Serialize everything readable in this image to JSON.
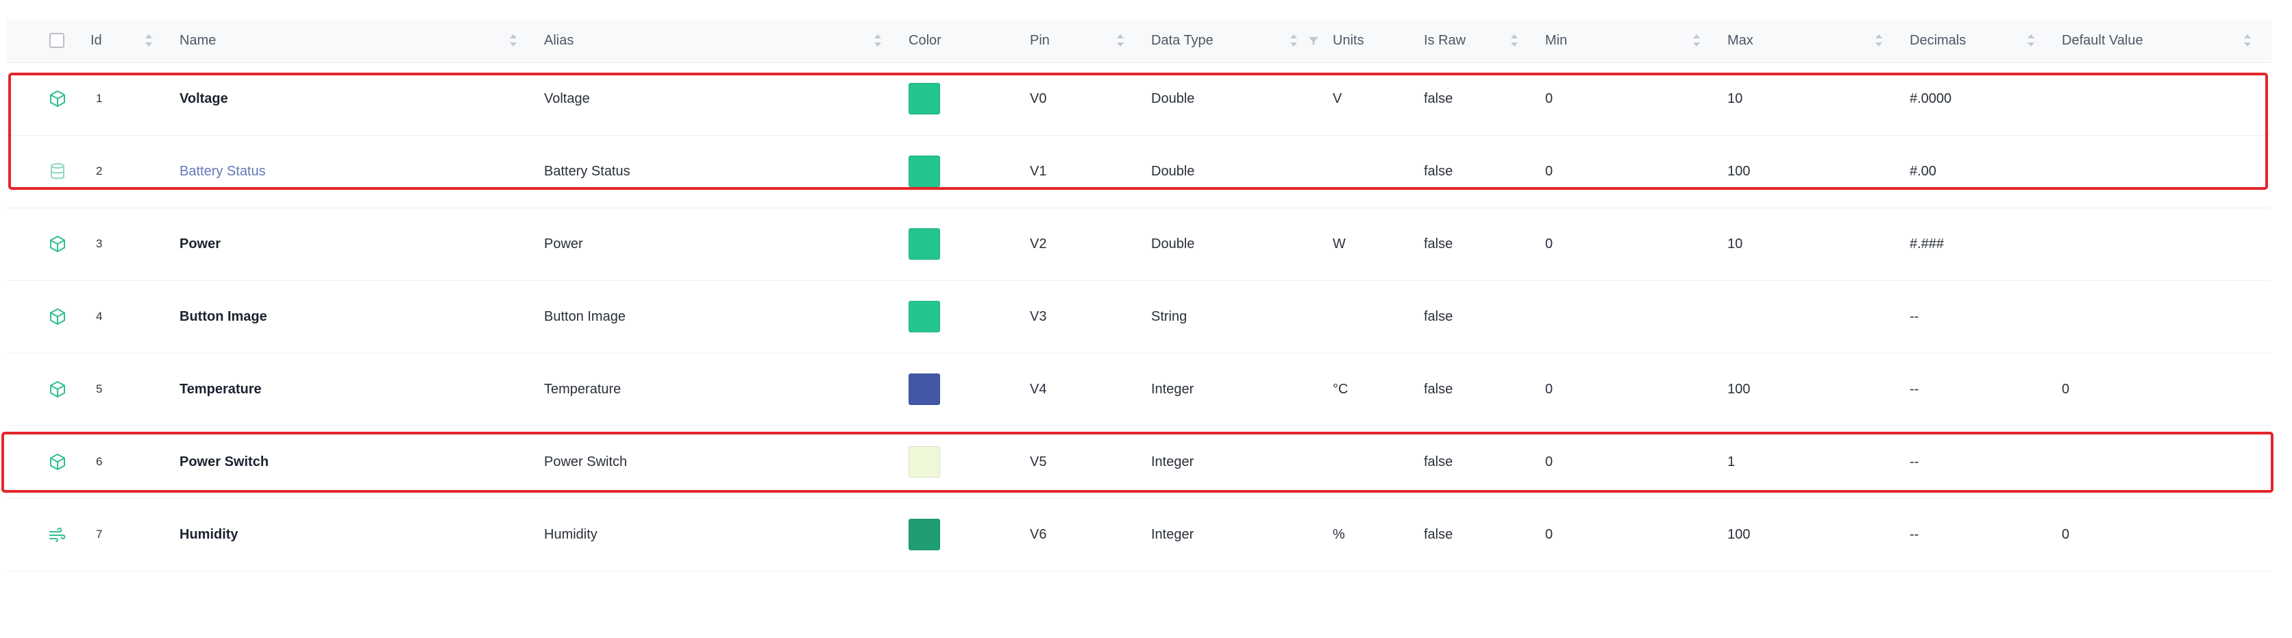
{
  "columns": {
    "id": "Id",
    "name": "Name",
    "alias": "Alias",
    "color": "Color",
    "pin": "Pin",
    "data_type": "Data Type",
    "units": "Units",
    "is_raw": "Is Raw",
    "min": "Min",
    "max": "Max",
    "decimals": "Decimals",
    "default_value": "Default Value"
  },
  "rows": [
    {
      "id": "1",
      "name": "Voltage",
      "alias": "Voltage",
      "color": "#24c48e",
      "pin": "V0",
      "data_type": "Double",
      "units": "V",
      "is_raw": "false",
      "min": "0",
      "max": "10",
      "decimals": "#.0000",
      "default_value": "",
      "icon": "cube-icon"
    },
    {
      "id": "2",
      "name": "Battery Status",
      "alias": "Battery Status",
      "color": "#24c48e",
      "pin": "V1",
      "data_type": "Double",
      "units": "",
      "is_raw": "false",
      "min": "0",
      "max": "100",
      "decimals": "#.00",
      "default_value": "",
      "icon": "cylinder-icon"
    },
    {
      "id": "3",
      "name": "Power",
      "alias": "Power",
      "color": "#24c48e",
      "pin": "V2",
      "data_type": "Double",
      "units": "W",
      "is_raw": "false",
      "min": "0",
      "max": "10",
      "decimals": "#.###",
      "default_value": "",
      "icon": "cube-icon"
    },
    {
      "id": "4",
      "name": "Button Image",
      "alias": "Button Image",
      "color": "#24c48e",
      "pin": "V3",
      "data_type": "String",
      "units": "",
      "is_raw": "false",
      "min": "",
      "max": "",
      "decimals": "--",
      "default_value": "",
      "icon": "cube-icon"
    },
    {
      "id": "5",
      "name": "Temperature",
      "alias": "Temperature",
      "color": "#4357a6",
      "pin": "V4",
      "data_type": "Integer",
      "units": "°C",
      "is_raw": "false",
      "min": "0",
      "max": "100",
      "decimals": "--",
      "default_value": "0",
      "icon": "cube-icon"
    },
    {
      "id": "6",
      "name": "Power Switch",
      "alias": "Power Switch",
      "color": "#eef7d8",
      "pin": "V5",
      "data_type": "Integer",
      "units": "",
      "is_raw": "false",
      "min": "0",
      "max": "1",
      "decimals": "--",
      "default_value": "",
      "icon": "cube-icon"
    },
    {
      "id": "7",
      "name": "Humidity",
      "alias": "Humidity",
      "color": "#1e9e72",
      "pin": "V6",
      "data_type": "Integer",
      "units": "%",
      "is_raw": "false",
      "min": "0",
      "max": "100",
      "decimals": "--",
      "default_value": "0",
      "icon": "wind-icon"
    }
  ],
  "colors": {
    "icon": "#2fbf8f",
    "highlight": "#e3262b",
    "link": "#6478b8"
  }
}
